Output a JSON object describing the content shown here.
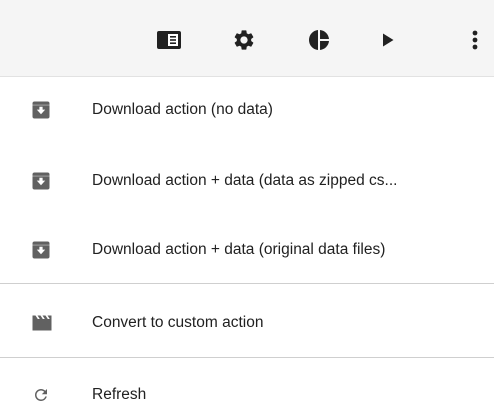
{
  "toolbar": {
    "buttons": [
      {
        "icon": "panel-toggle-icon"
      },
      {
        "icon": "gear-icon"
      },
      {
        "icon": "pie-chart-icon"
      },
      {
        "icon": "play-icon"
      },
      {
        "icon": "more-vertical-icon"
      }
    ]
  },
  "menu": {
    "items": [
      {
        "label": "Download action (no data)",
        "icon": "download-box-icon"
      },
      {
        "label": "Download action + data (data as zipped cs...",
        "icon": "download-box-icon"
      },
      {
        "label": "Download action + data (original data files)",
        "icon": "download-box-icon"
      },
      {
        "label": "Convert to custom action",
        "icon": "clapperboard-icon"
      },
      {
        "label": "Refresh",
        "icon": "refresh-icon"
      }
    ]
  },
  "colors": {
    "toolbar_bg": "#f5f5f5",
    "icon": "#212121",
    "menu_icon": "#616161",
    "divider": "#cfcfcf"
  }
}
